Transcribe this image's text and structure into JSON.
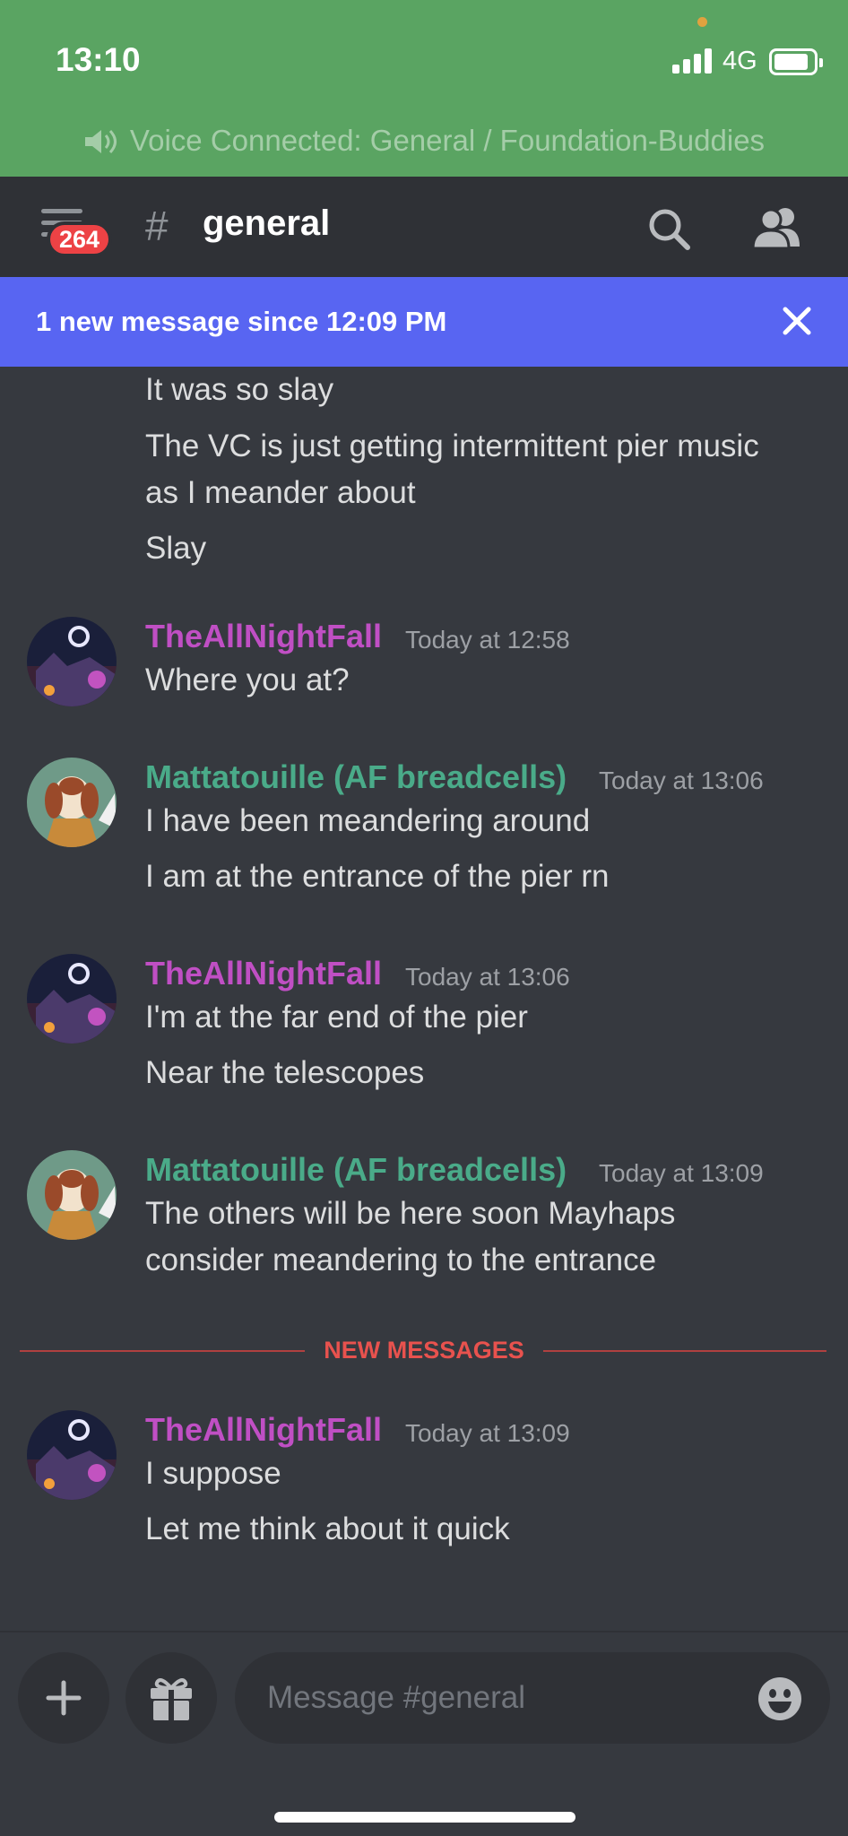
{
  "status_bar": {
    "time": "13:10",
    "network": "4G"
  },
  "voice": {
    "text": "Voice Connected: General / Foundation-Buddies"
  },
  "header": {
    "badge_count": "264",
    "hash": "#",
    "channel": "general"
  },
  "banner": {
    "text": "1 new message since 12:09 PM"
  },
  "messages": {
    "continued": [
      "It was so slay",
      "The VC is just getting intermittent pier music",
      "as I meander about",
      "Slay"
    ],
    "groups": [
      {
        "author": "TheAllNightFall",
        "timestamp": "Today at 12:58",
        "lines": [
          "Where you at?"
        ]
      },
      {
        "author": "Mattatouille (AF breadcells)",
        "timestamp": "Today at 13:06",
        "lines": [
          "I have been meandering around",
          "I am at the entrance of the pier rn"
        ]
      },
      {
        "author": "TheAllNightFall",
        "timestamp": "Today at 13:06",
        "lines": [
          "I'm at the far end of the pier",
          "Near the telescopes"
        ]
      },
      {
        "author": "Mattatouille (AF breadcells)",
        "timestamp": "Today at 13:09",
        "lines": [
          "The others will be here soon Mayhaps",
          "consider meandering to the entrance"
        ]
      },
      {
        "author": "TheAllNightFall",
        "timestamp": "Today at 13:09",
        "lines": [
          "I suppose",
          "Let me think about it quick"
        ]
      }
    ],
    "divider": "NEW MESSAGES"
  },
  "composer": {
    "placeholder": "Message #general"
  },
  "colors": {
    "status_green": "#5aa462",
    "blurple": "#5865f2",
    "allnightfall": "#c04fc4",
    "mattatouille": "#4aab89",
    "new_messages_red": "#e8524e",
    "background": "#36393f"
  }
}
